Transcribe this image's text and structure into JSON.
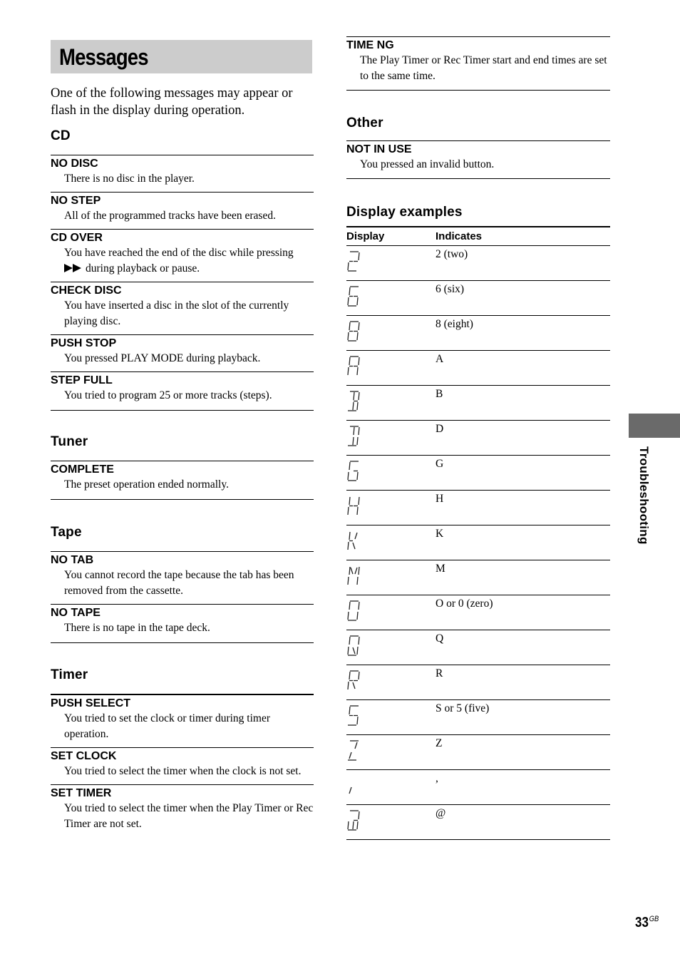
{
  "page": {
    "title": "Messages",
    "intro": "One of the following messages may appear or flash in the display during operation.",
    "side_tab_label": "Troubleshooting",
    "page_number": "33",
    "page_suffix": "GB"
  },
  "sections": {
    "cd": {
      "heading": "CD",
      "items": [
        {
          "name": "NO DISC",
          "desc": "There is no disc in the player."
        },
        {
          "name": "NO STEP",
          "desc": "All of the programmed tracks have been erased."
        },
        {
          "name": "CD OVER",
          "desc": "You have reached the end of the disc while pressing",
          "icon": "fast-forward-icon",
          "desc2": "during playback or pause."
        },
        {
          "name": "CHECK DISC",
          "desc": "You have inserted a disc in the slot of the currently playing disc."
        },
        {
          "name": "PUSH STOP",
          "desc": "You pressed PLAY MODE during playback."
        },
        {
          "name": "STEP FULL",
          "desc": "You tried to program 25 or more tracks (steps)."
        }
      ]
    },
    "tuner": {
      "heading": "Tuner",
      "items": [
        {
          "name": "COMPLETE",
          "desc": "The preset operation ended normally."
        }
      ]
    },
    "tape": {
      "heading": "Tape",
      "items": [
        {
          "name": "NO TAB",
          "desc": "You cannot record the tape because the tab has been removed from the cassette."
        },
        {
          "name": "NO TAPE",
          "desc": "There is no tape in the tape deck."
        }
      ]
    },
    "timer": {
      "heading": "Timer",
      "items": [
        {
          "name": "PUSH SELECT",
          "desc": "You tried to set the clock or timer during timer operation."
        },
        {
          "name": "SET CLOCK",
          "desc": "You tried to select the timer when the clock is not set."
        },
        {
          "name": "SET TIMER",
          "desc": "You tried to select the timer when the Play Timer or Rec Timer are not set."
        },
        {
          "name": "TIME NG",
          "desc": "The Play Timer or Rec Timer start and end times are set to the same time."
        }
      ]
    },
    "other": {
      "heading": "Other",
      "items": [
        {
          "name": "NOT IN USE",
          "desc": "You pressed an invalid button."
        }
      ]
    },
    "display_examples": {
      "heading": "Display examples",
      "columns": [
        "Display",
        "Indicates"
      ],
      "rows": [
        {
          "glyph": "2",
          "indicates": "2 (two)"
        },
        {
          "glyph": "6",
          "indicates": "6 (six)"
        },
        {
          "glyph": "8",
          "indicates": "8 (eight)"
        },
        {
          "glyph": "A",
          "indicates": "A"
        },
        {
          "glyph": "B",
          "indicates": "B"
        },
        {
          "glyph": "D",
          "indicates": "D"
        },
        {
          "glyph": "G",
          "indicates": "G"
        },
        {
          "glyph": "H",
          "indicates": "H"
        },
        {
          "glyph": "K",
          "indicates": "K"
        },
        {
          "glyph": "M",
          "indicates": "M"
        },
        {
          "glyph": "O",
          "indicates": "O or 0 (zero)"
        },
        {
          "glyph": "Q",
          "indicates": "Q"
        },
        {
          "glyph": "R",
          "indicates": "R"
        },
        {
          "glyph": "S",
          "indicates": "S or 5 (five)"
        },
        {
          "glyph": "Z",
          "indicates": "Z"
        },
        {
          "glyph": ",",
          "indicates": ","
        },
        {
          "glyph": "@",
          "indicates": "@"
        }
      ]
    }
  }
}
